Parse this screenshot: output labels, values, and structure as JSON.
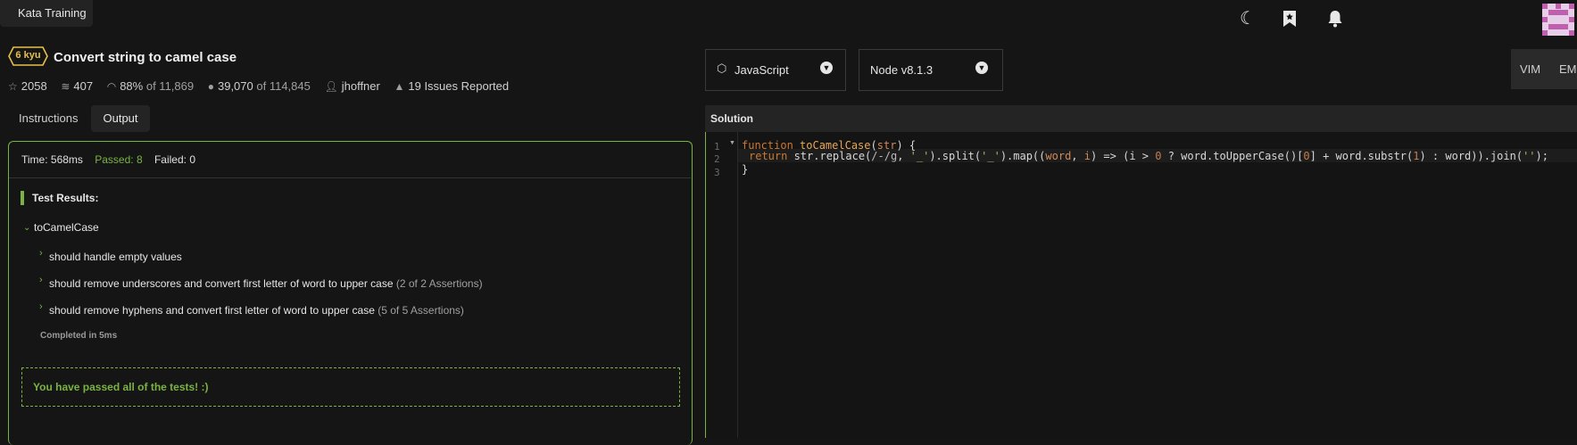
{
  "app": {
    "title": "Kata Training"
  },
  "header_icons": [
    "moon-icon",
    "bookmark-icon",
    "bell-icon",
    "avatar"
  ],
  "kata": {
    "rank": "6 kyu",
    "title": "Convert string to camel case",
    "stats": {
      "stars": "2058",
      "collections": "407",
      "satisfaction": "88%",
      "satisfaction_of": "of 11,869",
      "completions": "39,070",
      "completions_of": "of 114,845",
      "author": "jhoffner",
      "issues": "19 Issues Reported"
    }
  },
  "tabs": {
    "instructions": "Instructions",
    "output": "Output"
  },
  "output": {
    "time": "Time: 568ms",
    "passed": "Passed: 8",
    "failed": "Failed: 0",
    "results_label": "Test Results:",
    "suite": "toCamelCase",
    "tests": [
      {
        "name": "should handle empty values",
        "assertions": ""
      },
      {
        "name": "should remove underscores and convert first letter of word to upper case",
        "assertions": "(2 of 2 Assertions)"
      },
      {
        "name": "should remove hyphens and convert first letter of word to upper case",
        "assertions": "(5 of 5 Assertions)"
      }
    ],
    "completed": "Completed in 5ms",
    "pass_message": "You have passed all of the tests! :)"
  },
  "editor": {
    "language": "JavaScript",
    "runtime": "Node v8.1.3",
    "modes": [
      "VIM",
      "EM"
    ],
    "solution_label": "Solution",
    "line_numbers": [
      "1",
      "2",
      "3"
    ],
    "code": {
      "line1": {
        "kw": "function",
        "fn": "toCamelCase",
        "open": "(",
        "param": "str",
        "close": ") {"
      },
      "line2": {
        "kw": "return",
        "t1": " str.replace(",
        "regex": "/-/g",
        "t2": ", ",
        "s1": "'_'",
        "t3": ").split(",
        "s2": "'_'",
        "t4": ").map((",
        "p1": "word",
        "t5": ", ",
        "p2": "i",
        "t6": ") => (i > ",
        "n0": "0",
        "t7": " ? word.toUpperCase()[",
        "n1": "0",
        "t8": "] + word.substr(",
        "n2": "1",
        "t9": ") : word)).join(",
        "s3": "''",
        "t10": ");"
      },
      "line3": "}"
    }
  },
  "colors": {
    "accent_green": "#7ab342",
    "rank_yellow": "#e8c14a",
    "background": "#151515"
  }
}
